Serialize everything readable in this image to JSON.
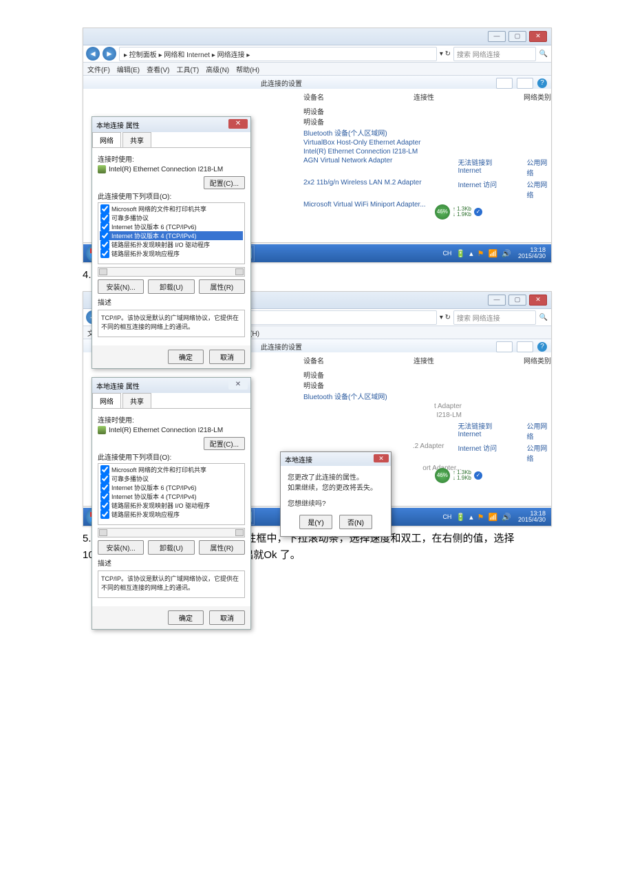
{
  "caption4": "4.弹出的对话框中，选择是",
  "caption5": "5.弹出的对话框中，选择高级，在属性框中，下拉滚动条，选择速度和双工，在右侧的值，选择10mbps全双工。然后一路确定，退出就Ok 了。",
  "explorer": {
    "breadcrumb": "▸ 控制面板 ▸ 网络和 Internet ▸ 网络连接 ▸",
    "search_placeholder": "搜索 网络连接",
    "menu": [
      "文件(F)",
      "编辑(E)",
      "查看(V)",
      "工具(T)",
      "高级(N)",
      "帮助(H)"
    ],
    "toolbar_hint": "此连接的设置",
    "col_device": "设备名",
    "col_conn": "连接性",
    "col_type": "网络类别",
    "cat1": "明设备",
    "cat2": "明设备",
    "rows": [
      {
        "name": "Bluetooth 设备(个人区域网)",
        "conn": "",
        "type": ""
      },
      {
        "name": "VirtualBox Host-Only Ethernet Adapter",
        "conn": "",
        "type": ""
      },
      {
        "name": "Intel(R) Ethernet Connection I218-LM",
        "conn": "",
        "type": ""
      },
      {
        "name": "AGN Virtual Network Adapter",
        "conn": "无法链接到 Internet",
        "type": "公用网络"
      },
      {
        "name": "2x2 11b/g/n Wireless LAN M.2 Adapter",
        "conn": "Internet 访问",
        "type": "公用网络"
      },
      {
        "name": "Microsoft Virtual WiFi Miniport Adapter...",
        "conn": "",
        "type": ""
      }
    ]
  },
  "prop": {
    "title": "本地连接 属性",
    "tab_net": "网络",
    "tab_share": "共享",
    "connect_using": "连接时使用:",
    "nic": "Intel(R) Ethernet Connection I218-LM",
    "configure": "配置(C)...",
    "items_label": "此连接使用下列项目(O):",
    "items": [
      "Microsoft 网络的文件和打印机共享",
      "可靠多播协议",
      "Internet 协议版本 6 (TCP/IPv6)",
      "Internet 协议版本 4 (TCP/IPv4)",
      "链路层拓扑发现映射器 I/O 驱动程序",
      "链路层拓扑发现响应程序"
    ],
    "install": "安装(N)...",
    "uninstall": "卸载(U)",
    "properties": "属性(R)",
    "desc_label": "描述",
    "desc": "TCP/IP。该协议是默认的广域网络协议，它提供在不同的相互连接的网络上的通讯。",
    "ok": "确定",
    "cancel": "取消"
  },
  "confirm": {
    "title": "本地连接",
    "line1": "您更改了此连接的属性。",
    "line2": "如果继续，您的更改将丢失。",
    "line3": "您想继续吗?",
    "yes": "是(Y)",
    "no": "否(N)"
  },
  "gauge": {
    "pct": "46%",
    "up": "↑ 1.3Kb",
    "down": "↓ 1.9Kb"
  },
  "tray": {
    "ime": "CH",
    "time": "13:18",
    "date": "2015/4/30"
  }
}
